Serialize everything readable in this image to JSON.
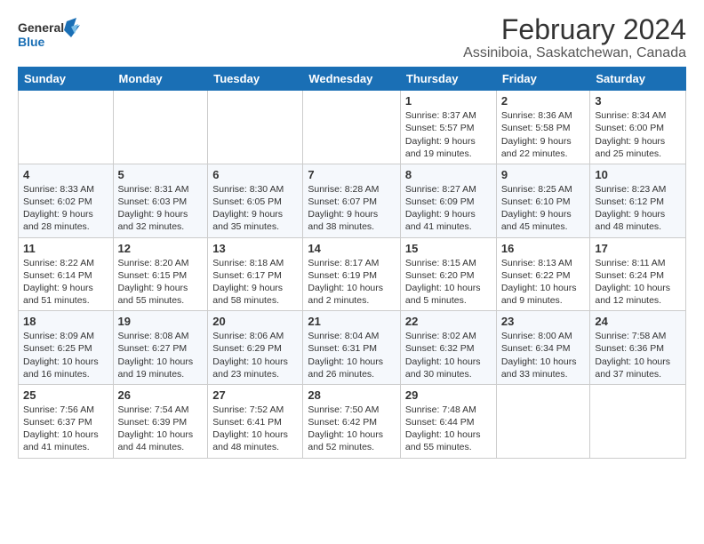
{
  "logo": {
    "line1": "General",
    "line2": "Blue"
  },
  "title": "February 2024",
  "subtitle": "Assiniboia, Saskatchewan, Canada",
  "days_of_week": [
    "Sunday",
    "Monday",
    "Tuesday",
    "Wednesday",
    "Thursday",
    "Friday",
    "Saturday"
  ],
  "weeks": [
    [
      {
        "day": "",
        "info": ""
      },
      {
        "day": "",
        "info": ""
      },
      {
        "day": "",
        "info": ""
      },
      {
        "day": "",
        "info": ""
      },
      {
        "day": "1",
        "info": "Sunrise: 8:37 AM\nSunset: 5:57 PM\nDaylight: 9 hours and 19 minutes."
      },
      {
        "day": "2",
        "info": "Sunrise: 8:36 AM\nSunset: 5:58 PM\nDaylight: 9 hours and 22 minutes."
      },
      {
        "day": "3",
        "info": "Sunrise: 8:34 AM\nSunset: 6:00 PM\nDaylight: 9 hours and 25 minutes."
      }
    ],
    [
      {
        "day": "4",
        "info": "Sunrise: 8:33 AM\nSunset: 6:02 PM\nDaylight: 9 hours and 28 minutes."
      },
      {
        "day": "5",
        "info": "Sunrise: 8:31 AM\nSunset: 6:03 PM\nDaylight: 9 hours and 32 minutes."
      },
      {
        "day": "6",
        "info": "Sunrise: 8:30 AM\nSunset: 6:05 PM\nDaylight: 9 hours and 35 minutes."
      },
      {
        "day": "7",
        "info": "Sunrise: 8:28 AM\nSunset: 6:07 PM\nDaylight: 9 hours and 38 minutes."
      },
      {
        "day": "8",
        "info": "Sunrise: 8:27 AM\nSunset: 6:09 PM\nDaylight: 9 hours and 41 minutes."
      },
      {
        "day": "9",
        "info": "Sunrise: 8:25 AM\nSunset: 6:10 PM\nDaylight: 9 hours and 45 minutes."
      },
      {
        "day": "10",
        "info": "Sunrise: 8:23 AM\nSunset: 6:12 PM\nDaylight: 9 hours and 48 minutes."
      }
    ],
    [
      {
        "day": "11",
        "info": "Sunrise: 8:22 AM\nSunset: 6:14 PM\nDaylight: 9 hours and 51 minutes."
      },
      {
        "day": "12",
        "info": "Sunrise: 8:20 AM\nSunset: 6:15 PM\nDaylight: 9 hours and 55 minutes."
      },
      {
        "day": "13",
        "info": "Sunrise: 8:18 AM\nSunset: 6:17 PM\nDaylight: 9 hours and 58 minutes."
      },
      {
        "day": "14",
        "info": "Sunrise: 8:17 AM\nSunset: 6:19 PM\nDaylight: 10 hours and 2 minutes."
      },
      {
        "day": "15",
        "info": "Sunrise: 8:15 AM\nSunset: 6:20 PM\nDaylight: 10 hours and 5 minutes."
      },
      {
        "day": "16",
        "info": "Sunrise: 8:13 AM\nSunset: 6:22 PM\nDaylight: 10 hours and 9 minutes."
      },
      {
        "day": "17",
        "info": "Sunrise: 8:11 AM\nSunset: 6:24 PM\nDaylight: 10 hours and 12 minutes."
      }
    ],
    [
      {
        "day": "18",
        "info": "Sunrise: 8:09 AM\nSunset: 6:25 PM\nDaylight: 10 hours and 16 minutes."
      },
      {
        "day": "19",
        "info": "Sunrise: 8:08 AM\nSunset: 6:27 PM\nDaylight: 10 hours and 19 minutes."
      },
      {
        "day": "20",
        "info": "Sunrise: 8:06 AM\nSunset: 6:29 PM\nDaylight: 10 hours and 23 minutes."
      },
      {
        "day": "21",
        "info": "Sunrise: 8:04 AM\nSunset: 6:31 PM\nDaylight: 10 hours and 26 minutes."
      },
      {
        "day": "22",
        "info": "Sunrise: 8:02 AM\nSunset: 6:32 PM\nDaylight: 10 hours and 30 minutes."
      },
      {
        "day": "23",
        "info": "Sunrise: 8:00 AM\nSunset: 6:34 PM\nDaylight: 10 hours and 33 minutes."
      },
      {
        "day": "24",
        "info": "Sunrise: 7:58 AM\nSunset: 6:36 PM\nDaylight: 10 hours and 37 minutes."
      }
    ],
    [
      {
        "day": "25",
        "info": "Sunrise: 7:56 AM\nSunset: 6:37 PM\nDaylight: 10 hours and 41 minutes."
      },
      {
        "day": "26",
        "info": "Sunrise: 7:54 AM\nSunset: 6:39 PM\nDaylight: 10 hours and 44 minutes."
      },
      {
        "day": "27",
        "info": "Sunrise: 7:52 AM\nSunset: 6:41 PM\nDaylight: 10 hours and 48 minutes."
      },
      {
        "day": "28",
        "info": "Sunrise: 7:50 AM\nSunset: 6:42 PM\nDaylight: 10 hours and 52 minutes."
      },
      {
        "day": "29",
        "info": "Sunrise: 7:48 AM\nSunset: 6:44 PM\nDaylight: 10 hours and 55 minutes."
      },
      {
        "day": "",
        "info": ""
      },
      {
        "day": "",
        "info": ""
      }
    ]
  ]
}
